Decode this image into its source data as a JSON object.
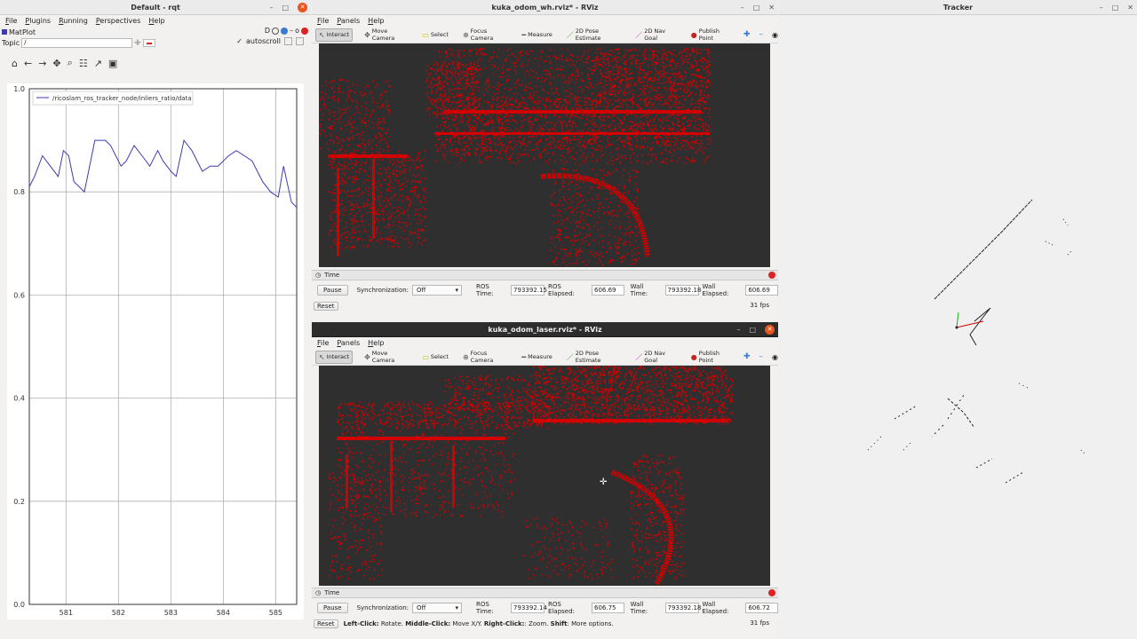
{
  "rqt": {
    "title": "Default - rqt",
    "menu": [
      "File",
      "Plugins",
      "Running",
      "Perspectives",
      "Help"
    ],
    "plugin_name": "MatPlot",
    "plugin_ctrls": "D",
    "topic_label": "Topic",
    "topic_value": "/",
    "autoscroll_label": "autoscroll",
    "chart_data": {
      "type": "line",
      "series": [
        {
          "name": "/ricoslam_ros_tracker_node/inliers_ratio/data",
          "color": "#3b3bb0",
          "x": [
            580.3,
            580.4,
            580.55,
            580.7,
            580.85,
            580.95,
            581.05,
            581.15,
            581.25,
            581.35,
            581.55,
            581.75,
            581.85,
            582.05,
            582.15,
            582.3,
            582.45,
            582.6,
            582.75,
            582.85,
            583.0,
            583.1,
            583.25,
            583.4,
            583.6,
            583.75,
            583.9,
            584.1,
            584.25,
            584.4,
            584.55,
            584.65,
            584.75,
            584.9,
            585.05,
            585.15,
            585.3,
            585.4
          ],
          "values": [
            0.81,
            0.83,
            0.87,
            0.85,
            0.83,
            0.88,
            0.87,
            0.82,
            0.81,
            0.8,
            0.9,
            0.9,
            0.89,
            0.85,
            0.86,
            0.89,
            0.87,
            0.85,
            0.88,
            0.86,
            0.84,
            0.83,
            0.9,
            0.88,
            0.84,
            0.85,
            0.85,
            0.87,
            0.88,
            0.87,
            0.86,
            0.84,
            0.82,
            0.8,
            0.79,
            0.85,
            0.78,
            0.77
          ]
        }
      ],
      "xticks": [
        "581",
        "582",
        "583",
        "584",
        "585"
      ],
      "xtick_values": [
        581,
        582,
        583,
        584,
        585
      ],
      "yticks": [
        "0.0",
        "0.2",
        "0.4",
        "0.6",
        "0.8",
        "1.0"
      ],
      "ytick_values": [
        0,
        0.2,
        0.4,
        0.6,
        0.8,
        1.0
      ],
      "xlim": [
        580.3,
        585.4
      ],
      "ylim": [
        0,
        1.0
      ],
      "grid": true,
      "legend": "top-left"
    }
  },
  "rviz_top": {
    "title": "kuka_odom_wh.rviz* - RViz",
    "menu": [
      "File",
      "Panels",
      "Help"
    ],
    "tools": [
      "Interact",
      "Move Camera",
      "Select",
      "Focus Camera",
      "Measure",
      "2D Pose Estimate",
      "2D Nav Goal",
      "Publish Point"
    ],
    "time_panel": "Time",
    "pause": "Pause",
    "sync_label": "Synchronization:",
    "sync_value": "Off",
    "ros_time_label": "ROS Time:",
    "ros_time": "793392.15",
    "ros_elapsed_label": "ROS Elapsed:",
    "ros_elapsed": "606.69",
    "wall_time_label": "Wall Time:",
    "wall_time": "793392.18",
    "wall_elapsed_label": "Wall Elapsed:",
    "wall_elapsed": "606.69",
    "reset": "Reset",
    "fps": "31 fps"
  },
  "rviz_bottom": {
    "title": "kuka_odom_laser.rviz* - RViz",
    "menu": [
      "File",
      "Panels",
      "Help"
    ],
    "tools": [
      "Interact",
      "Move Camera",
      "Select",
      "Focus Camera",
      "Measure",
      "2D Pose Estimate",
      "2D Nav Goal",
      "Publish Point"
    ],
    "time_panel": "Time",
    "pause": "Pause",
    "sync_label": "Synchronization:",
    "sync_value": "Off",
    "ros_time_label": "ROS Time:",
    "ros_time": "793392.14",
    "ros_elapsed_label": "ROS Elapsed:",
    "ros_elapsed": "606.75",
    "wall_time_label": "Wall Time:",
    "wall_time": "793392.18",
    "wall_elapsed_label": "Wall Elapsed:",
    "wall_elapsed": "606.72",
    "reset": "Reset",
    "status_hint_1": "Left-Click:",
    "status_hint_1b": " Rotate. ",
    "status_hint_2": "Middle-Click:",
    "status_hint_2b": " Move X/Y. ",
    "status_hint_3": "Right-Click:",
    "status_hint_3b": ": Zoom. ",
    "status_hint_4": "Shift",
    "status_hint_4b": ": More options.",
    "fps": "31 fps"
  },
  "tracker": {
    "title": "Tracker"
  },
  "colors": {
    "pointcloud": "#d40000",
    "viewport_bg": "#2f2f2f",
    "plot_line": "#3b3bb0"
  }
}
